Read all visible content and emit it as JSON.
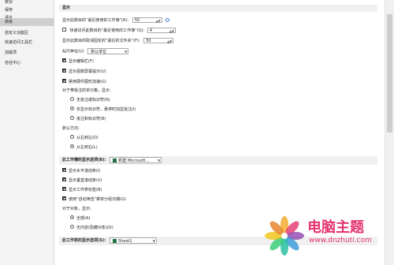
{
  "sidebar": {
    "items": [
      {
        "label": "校对",
        "active": false
      },
      {
        "label": "保存",
        "active": false
      },
      {
        "label": "语言",
        "active": false
      },
      {
        "label": "高级",
        "active": true
      },
      {
        "label": "自定义功能区",
        "active": false
      },
      {
        "label": "快速访问工具栏",
        "active": false
      },
      {
        "label": "加载项",
        "active": false
      },
      {
        "label": "信任中心",
        "active": false
      }
    ]
  },
  "display": {
    "section_title": "显示",
    "recent_workbooks_label": "显示此数目的“最近使用的工作簿”(R):",
    "recent_workbooks_value": "50",
    "quick_access_label": "快速访问此数目的“最近使用的工作簿”(Q):",
    "quick_access_value": "4",
    "unpinned_folders_label": "显示此数目的取消固定的“最近的文件夹”(F):",
    "unpinned_folders_value": "50",
    "ruler_units_label": "标尺单位(U)",
    "ruler_units_value": "默认单位",
    "show_formula_bar": "显示编辑栏(F)",
    "show_function_tooltips": "显示函数屏幕提示(U)",
    "disable_hw_accel": "禁用硬件图形加速(G)",
    "comments_label": "对于带批注的单元格，显示:",
    "no_comments": "无批注或标识符(N)",
    "indicators_only": "仅显示标识符，悬停时加显批注(I)",
    "comments_and_indicators": "批注和标识符(B)",
    "default_direction_label": "默认方向:",
    "right_to_left": "从右到左(D)",
    "left_to_right": "从左到右(L)"
  },
  "workbook": {
    "section_label": "此工作簿的显示选项(B):",
    "select_value": "新建 Microsoft...",
    "show_hscroll": "显示水平滚动条(I)",
    "show_vscroll": "显示垂直滚动条(V)",
    "show_sheet_tabs": "显示工作表标签(B)",
    "group_dates": "使用“自动筛选”菜单分组日期(G)",
    "objects_label": "对于对象，显示:",
    "all": "全部(A)",
    "nothing": "无内容(隐藏对象)(D)"
  },
  "worksheet": {
    "section_label": "此工作表的显示选项(S):",
    "select_value": "Sheet1"
  },
  "watermark": {
    "title": "电脑主题",
    "url": "www.dnzhuti.com"
  }
}
